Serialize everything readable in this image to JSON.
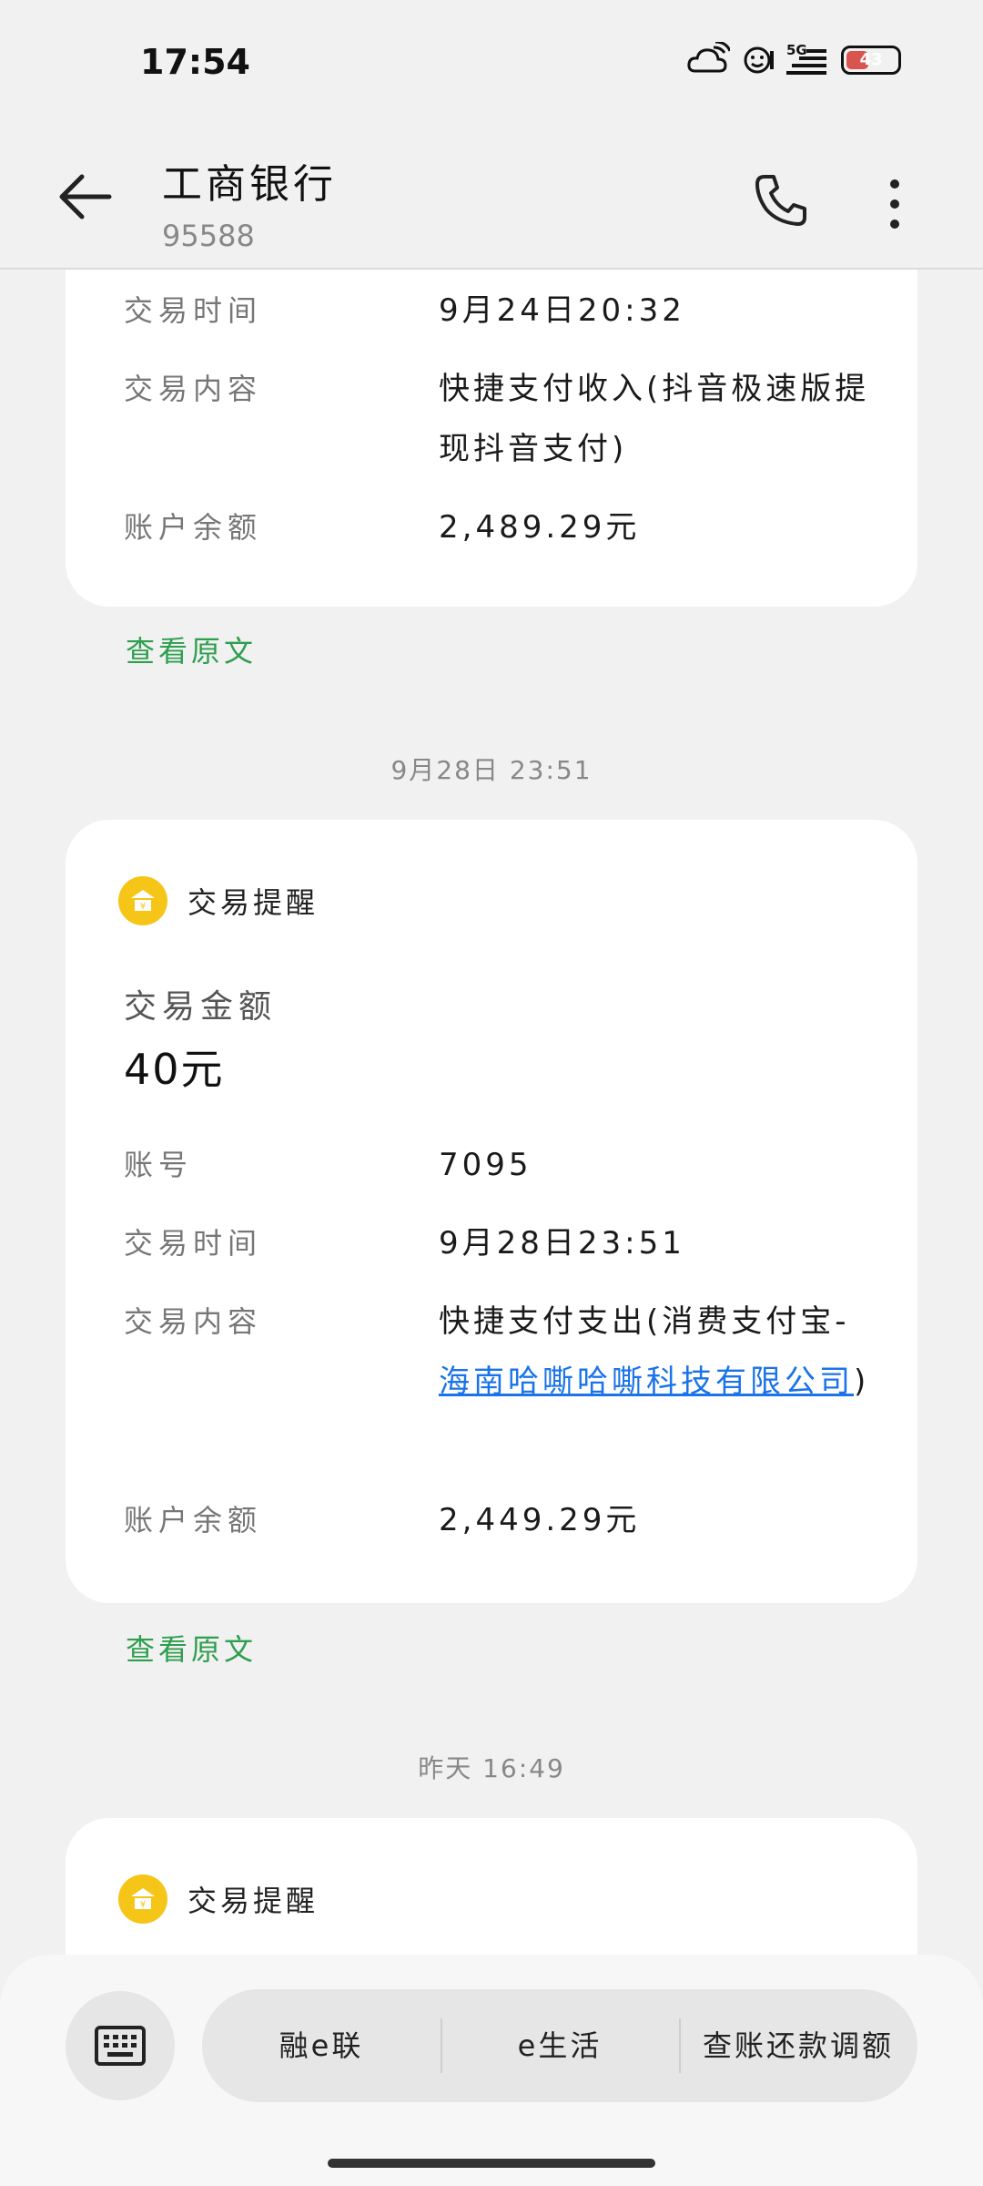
{
  "status_bar": {
    "time": "17:54",
    "battery_level": "43",
    "icons": [
      "cloud-wifi-icon",
      "face-icon",
      "5g-signal-icon",
      "battery-icon"
    ]
  },
  "header": {
    "title": "工商银行",
    "subtitle": "95588",
    "icons": [
      "back-arrow-icon",
      "phone-icon",
      "more-vertical-icon"
    ]
  },
  "messages": [
    {
      "rows": [
        {
          "label": "交易时间",
          "value": "9月24日20:32"
        },
        {
          "label": "交易内容",
          "value": "快捷支付收入(抖音极速版提现抖音支付)"
        },
        {
          "label": "账户余额",
          "value": "2,489.29元"
        }
      ],
      "view_original": "查看原文"
    },
    {
      "date": "9月28日 23:51",
      "card_title": "交易提醒",
      "amount_label": "交易金额",
      "amount_value": "40元",
      "rows": [
        {
          "label": "账号",
          "value": "7095"
        },
        {
          "label": "交易时间",
          "value": "9月28日23:51"
        },
        {
          "label": "交易内容",
          "value_prefix": "快捷支付支出(消费支付宝-",
          "value_link": "海南哈嘶哈嘶科技有限公司",
          "value_suffix": ")"
        },
        {
          "label": "账户余额",
          "value": "2,449.29元"
        }
      ],
      "view_original": "查看原文"
    },
    {
      "date": "昨天 16:49",
      "card_title": "交易提醒"
    }
  ],
  "bottom_bar": {
    "menu": [
      "融e联",
      "e生活",
      "查账还款调额"
    ],
    "icons": [
      "keyboard-icon"
    ]
  },
  "colors": {
    "background": "#f1f1f1",
    "card": "#ffffff",
    "link": "#1a73e8",
    "view_original": "#2e9e4f",
    "bank_icon": "#f5c518"
  }
}
